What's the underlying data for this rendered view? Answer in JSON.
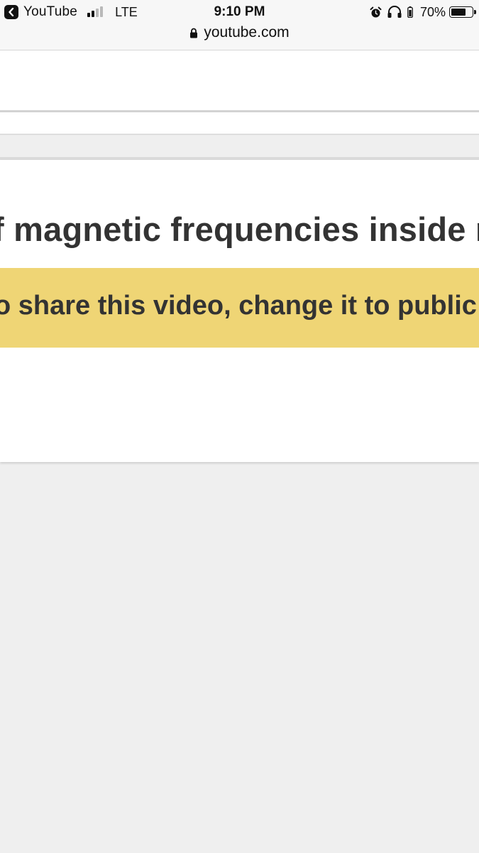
{
  "status_bar": {
    "back_app": "YouTube",
    "network": "LTE",
    "time": "9:10 PM",
    "battery_percent": "70%",
    "battery_level": 0.7,
    "signal_bars_filled": 2,
    "signal_bars_total": 4,
    "icons": [
      "back-chevron-icon",
      "signal-icon",
      "alarm-icon",
      "headphones-icon",
      "battery-icon"
    ]
  },
  "address_bar": {
    "url": "youtube.com",
    "secure_icon": "lock-icon"
  },
  "video": {
    "title_fragment": "f magnetic frequencies inside m"
  },
  "privacy_banner": {
    "text_fragment": "o share this video, change it to public or",
    "color": "#efd575"
  },
  "colors": {
    "page_background": "#efefef",
    "text": "#333333"
  }
}
